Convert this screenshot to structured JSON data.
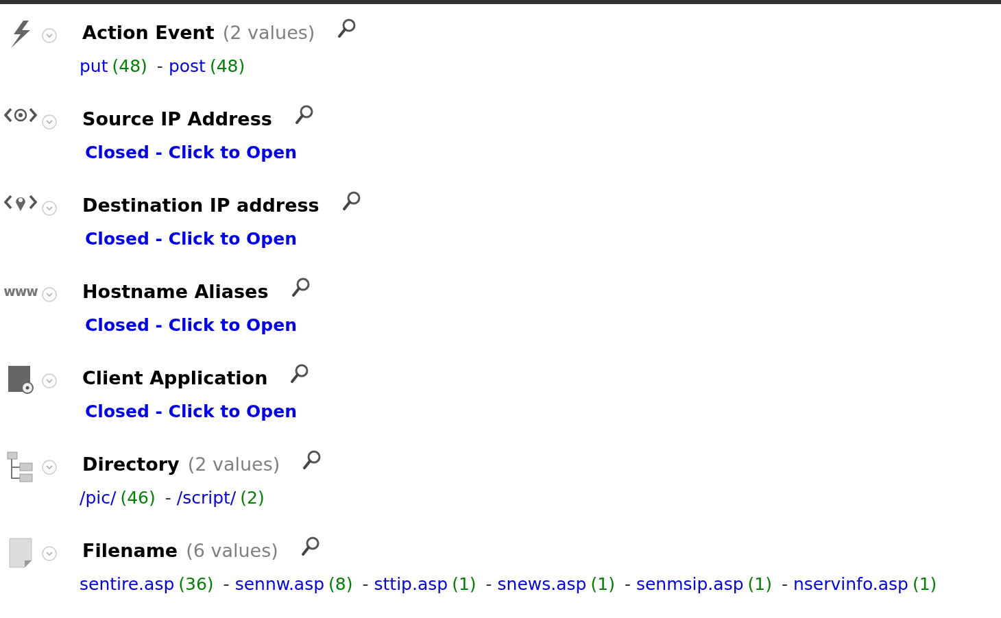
{
  "sections": [
    {
      "title": "Action Event",
      "count": "(2 values)",
      "kind": "values",
      "separator": "-",
      "values": [
        {
          "name": "put",
          "count": "(48)"
        },
        {
          "name": "post",
          "count": "(48)"
        }
      ]
    },
    {
      "title": "Source IP Address",
      "kind": "closed",
      "status": "Closed - Click to Open"
    },
    {
      "title": "Destination IP address",
      "kind": "closed",
      "status": "Closed - Click to Open"
    },
    {
      "icon_text": "www",
      "title": "Hostname Aliases",
      "kind": "closed",
      "status": "Closed - Click to Open"
    },
    {
      "title": "Client Application",
      "kind": "closed",
      "status": "Closed - Click to Open"
    },
    {
      "title": "Directory",
      "count": "(2 values)",
      "kind": "values",
      "separator": "-",
      "values": [
        {
          "name": "/pic/",
          "count": "(46)"
        },
        {
          "name": "/script/",
          "count": "(2)"
        }
      ]
    },
    {
      "title": "Filename",
      "count": "(6 values)",
      "kind": "values",
      "separator": "-",
      "values": [
        {
          "name": "sentire.asp",
          "count": "(36)"
        },
        {
          "name": "sennw.asp",
          "count": "(8)"
        },
        {
          "name": "sttip.asp",
          "count": "(1)"
        },
        {
          "name": "snews.asp",
          "count": "(1)"
        },
        {
          "name": "senmsip.asp",
          "count": "(1)"
        },
        {
          "name": "nservinfo.asp",
          "count": "(1)"
        }
      ]
    }
  ]
}
